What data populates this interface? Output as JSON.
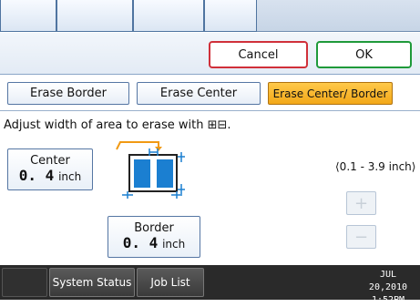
{
  "actions": {
    "cancel_label": "Cancel",
    "ok_label": "OK"
  },
  "modes": [
    {
      "label": "Erase Border",
      "selected": false
    },
    {
      "label": "Erase Center",
      "selected": false
    },
    {
      "label": "Erase Center/ Border",
      "selected": true
    }
  ],
  "instruction": "Adjust width of area to erase with ⊞⊟.",
  "center": {
    "label": "Center",
    "value": "0. 4",
    "unit": "inch"
  },
  "border": {
    "label": "Border",
    "value": "0. 4",
    "unit": "inch"
  },
  "range_text": "⟨0.1 - 3.9 inch⟩",
  "stepper": {
    "plus": "+",
    "minus": "−"
  },
  "footer": {
    "system_status_label": "System Status",
    "job_list_label": "Job List",
    "date": "JUL  20,2010",
    "time": "1:52PM"
  },
  "colors": {
    "selected_tab": "#f3a818",
    "cancel_border": "#d0303a",
    "ok_border": "#1f9a3a",
    "diagram_fill": "#1b7fd1"
  }
}
